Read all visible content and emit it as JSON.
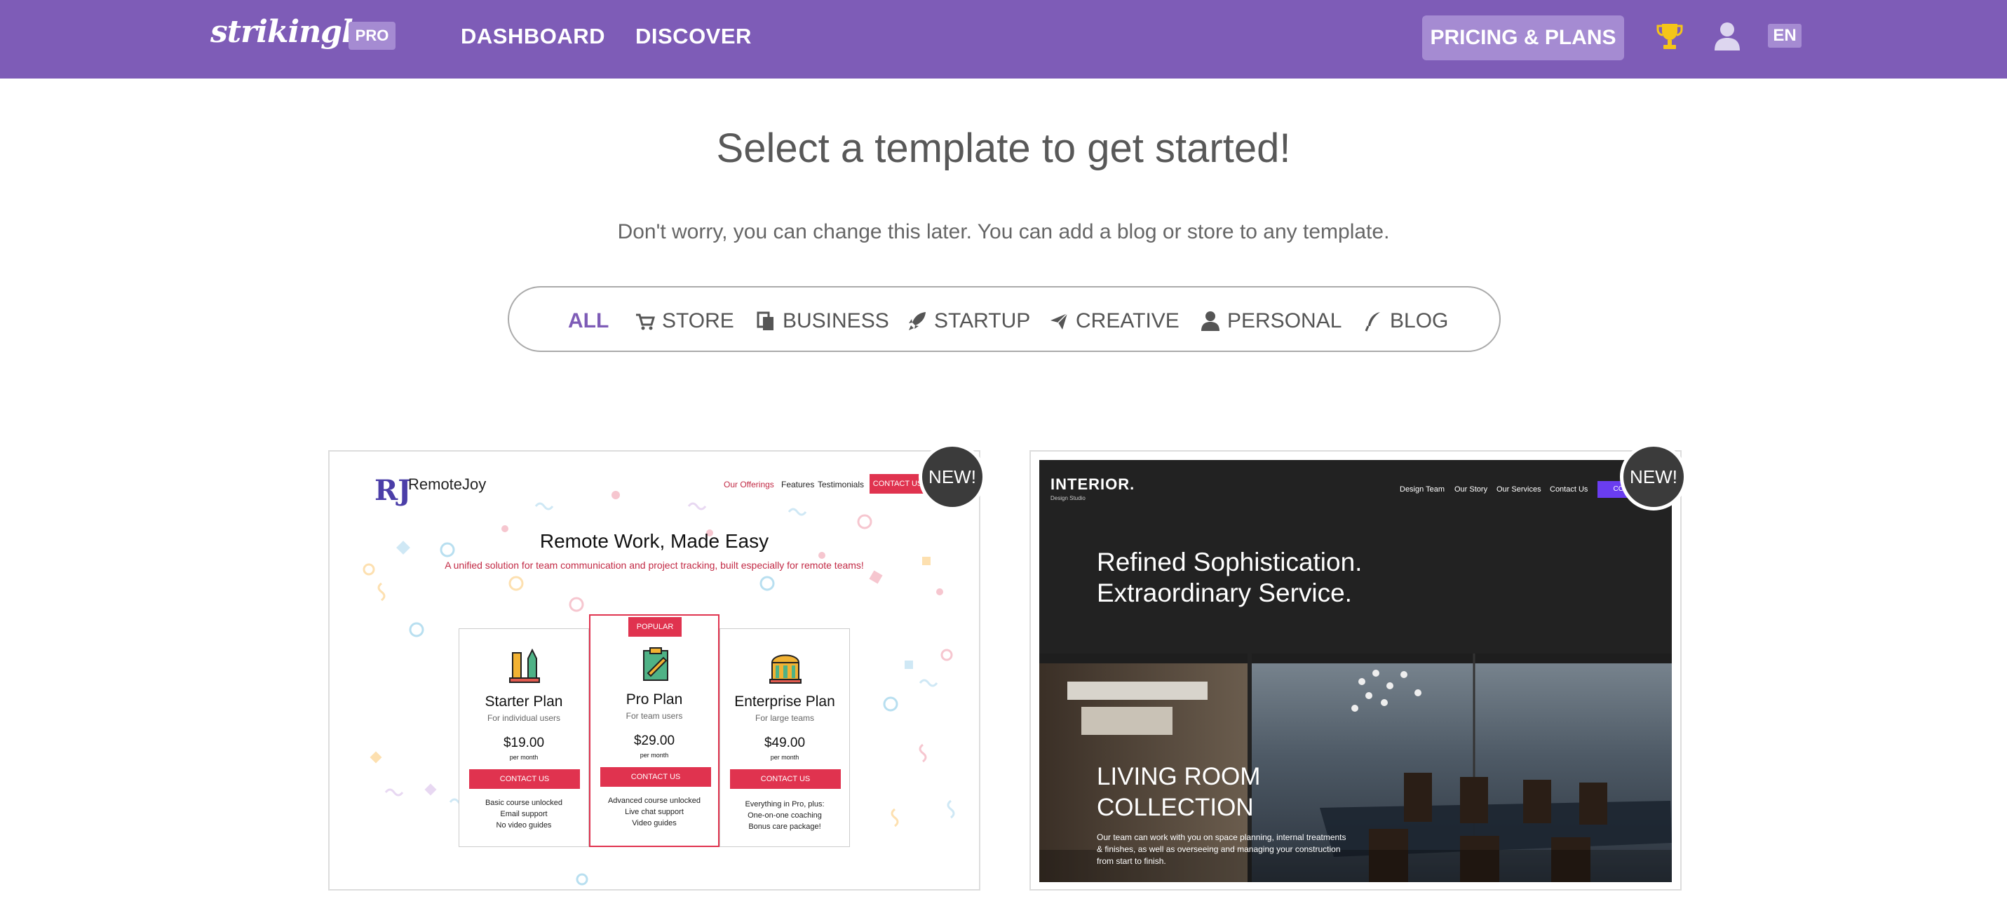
{
  "app": {
    "logo_text": "strikingly",
    "pro_badge": "PRO"
  },
  "header": {
    "nav": [
      "DASHBOARD",
      "DISCOVER"
    ],
    "pricing_label": "PRICING & PLANS",
    "language": "EN",
    "icons": [
      "trophy-icon",
      "user-icon"
    ]
  },
  "main": {
    "title": "Select a template to get started!",
    "subtitle": "Don't worry, you can change this later. You can add a blog or store to any template."
  },
  "filters": {
    "active": "ALL",
    "items": [
      {
        "label": "ALL",
        "icon": ""
      },
      {
        "label": "STORE",
        "icon": "cart-icon"
      },
      {
        "label": "BUSINESS",
        "icon": "document-icon"
      },
      {
        "label": "STARTUP",
        "icon": "rocket-icon"
      },
      {
        "label": "CREATIVE",
        "icon": "paper-plane-icon"
      },
      {
        "label": "PERSONAL",
        "icon": "person-icon"
      },
      {
        "label": "BLOG",
        "icon": "quill-icon"
      }
    ]
  },
  "colors": {
    "brand": "#7e5cb7",
    "brand_light": "#a58bd2",
    "accent_red": "#e0334f"
  },
  "templates": [
    {
      "badge": "NEW!",
      "logo": "RJ",
      "name": "RemoteJoy",
      "nav": [
        "Our Offerings",
        "Features",
        "Testimonials"
      ],
      "nav_cta": "CONTACT US",
      "headline": "Remote Work, Made Easy",
      "subheadline": "A unified solution for team communication and project tracking, built especially for remote teams!",
      "plans": [
        {
          "name": "Starter Plan",
          "for": "For individual users",
          "price": "$19.00",
          "per": "per month",
          "cta": "CONTACT US",
          "features": [
            "Basic course unlocked",
            "Email support",
            "No video guides"
          ]
        },
        {
          "name": "Pro Plan",
          "for": "For team users",
          "price": "$29.00",
          "per": "per month",
          "cta": "CONTACT US",
          "tag": "POPULAR",
          "features": [
            "Advanced course unlocked",
            "Live chat support",
            "Video guides"
          ]
        },
        {
          "name": "Enterprise Plan",
          "for": "For large teams",
          "price": "$49.00",
          "per": "per month",
          "cta": "CONTACT US",
          "features": [
            "Everything in Pro, plus:",
            "One-on-one coaching",
            "Bonus care package!"
          ]
        }
      ]
    },
    {
      "badge": "NEW!",
      "brand": "INTERIOR.",
      "tagline": "Design Studio",
      "nav": [
        "Design Team",
        "Our Story",
        "Our Services",
        "Contact Us"
      ],
      "nav_cta": "CO",
      "headline_line1": "Refined Sophistication.",
      "headline_line2": "Extraordinary Service.",
      "collection_line1": "LIVING ROOM",
      "collection_line2": "COLLECTION",
      "description": "Our team can work with you on space planning, internal treatments & finishes, as well as overseeing and managing your construction from start to finish."
    }
  ]
}
